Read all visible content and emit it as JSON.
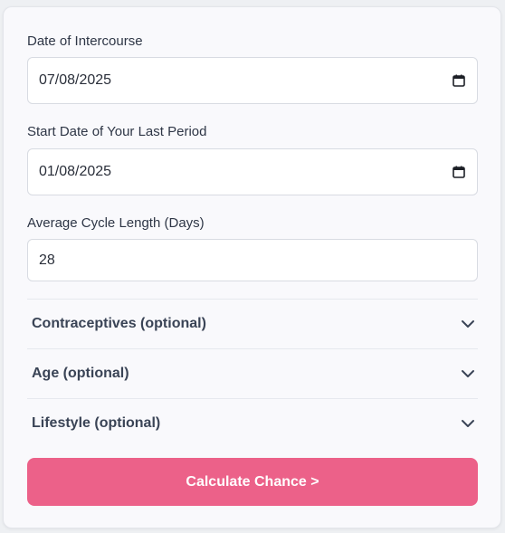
{
  "form": {
    "intercourse_label": "Date of Intercourse",
    "intercourse_value": "07/08/2025",
    "period_label": "Start Date of Your Last Period",
    "period_value": "01/08/2025",
    "cycle_label": "Average Cycle Length (Days)",
    "cycle_value": "28"
  },
  "sections": [
    {
      "label": "Contraceptives (optional)",
      "icon": "chevron-down-icon"
    },
    {
      "label": "Age (optional)",
      "icon": "chevron-down-icon"
    },
    {
      "label": "Lifestyle (optional)",
      "icon": "chevron-down-icon"
    }
  ],
  "action": {
    "calculate_label": "Calculate Chance >"
  },
  "colors": {
    "accent": "#ec6189",
    "card_bg": "#f9f9fc"
  }
}
